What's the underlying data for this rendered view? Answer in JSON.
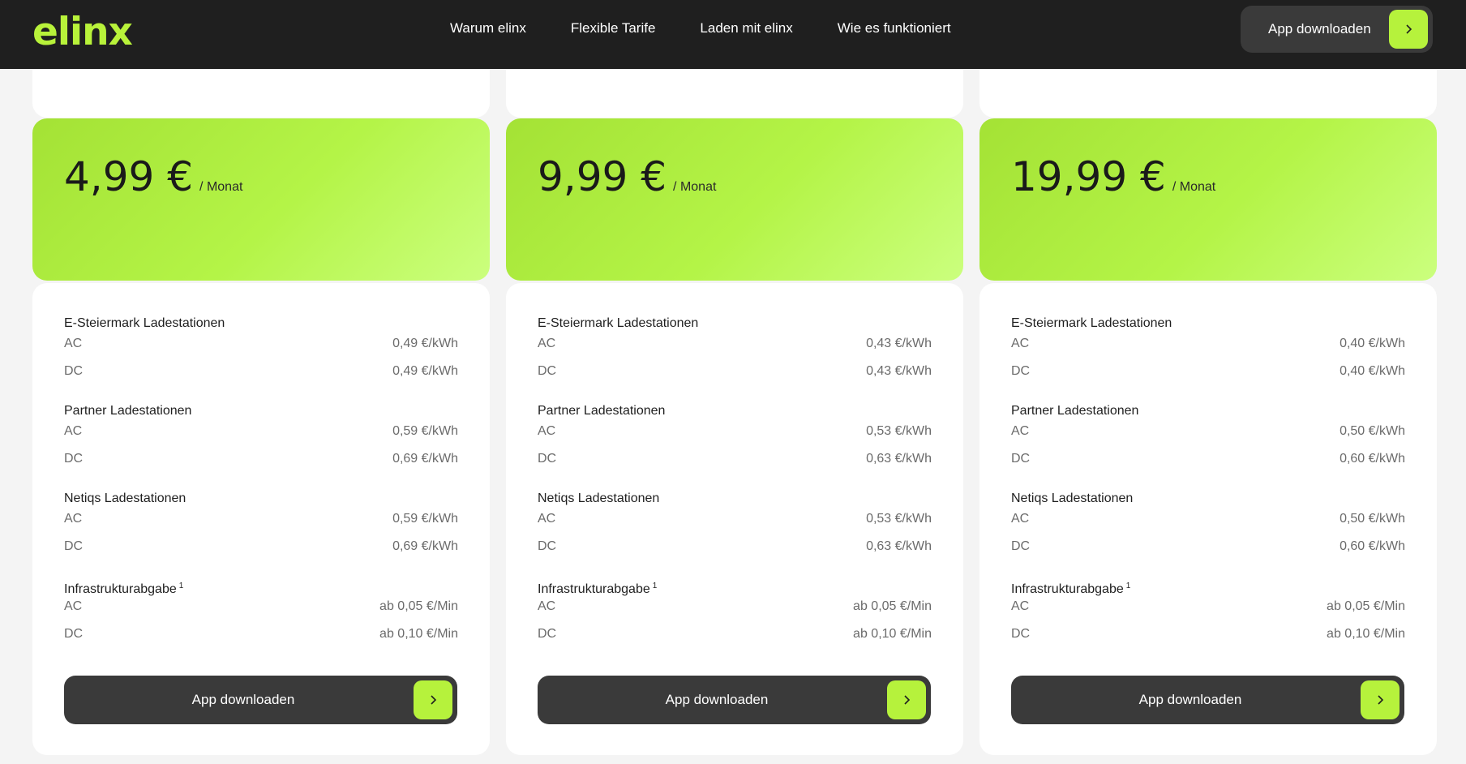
{
  "header": {
    "logo": "elinx",
    "nav": [
      "Warum elinx",
      "Flexible Tarife",
      "Laden mit elinx",
      "Wie es funktioniert"
    ],
    "cta_label": "App downloaden"
  },
  "plans": [
    {
      "price": "4,99 €",
      "period": "/ Monat",
      "groups": [
        {
          "title": "E-Steiermark Ladestationen",
          "rows": [
            {
              "label": "AC",
              "value": "0,49 €/kWh"
            },
            {
              "label": "DC",
              "value": "0,49 €/kWh"
            }
          ]
        },
        {
          "title": "Partner Ladestationen",
          "rows": [
            {
              "label": "AC",
              "value": "0,59 €/kWh"
            },
            {
              "label": "DC",
              "value": "0,69 €/kWh"
            }
          ]
        },
        {
          "title": "Netiqs Ladestationen",
          "rows": [
            {
              "label": "AC",
              "value": "0,59 €/kWh"
            },
            {
              "label": "DC",
              "value": "0,69 €/kWh"
            }
          ]
        },
        {
          "title": "Infrastrukturabgabe",
          "footnote": "1",
          "rows": [
            {
              "label": "AC",
              "value": "ab 0,05 €/Min"
            },
            {
              "label": "DC",
              "value": "ab 0,10 €/Min"
            }
          ]
        }
      ],
      "button": "App downloaden"
    },
    {
      "price": "9,99 €",
      "period": "/ Monat",
      "groups": [
        {
          "title": "E-Steiermark Ladestationen",
          "rows": [
            {
              "label": "AC",
              "value": "0,43 €/kWh"
            },
            {
              "label": "DC",
              "value": "0,43 €/kWh"
            }
          ]
        },
        {
          "title": "Partner Ladestationen",
          "rows": [
            {
              "label": "AC",
              "value": "0,53 €/kWh"
            },
            {
              "label": "DC",
              "value": "0,63 €/kWh"
            }
          ]
        },
        {
          "title": "Netiqs Ladestationen",
          "rows": [
            {
              "label": "AC",
              "value": "0,53 €/kWh"
            },
            {
              "label": "DC",
              "value": "0,63 €/kWh"
            }
          ]
        },
        {
          "title": "Infrastrukturabgabe",
          "footnote": "1",
          "rows": [
            {
              "label": "AC",
              "value": "ab 0,05 €/Min"
            },
            {
              "label": "DC",
              "value": "ab 0,10 €/Min"
            }
          ]
        }
      ],
      "button": "App downloaden"
    },
    {
      "price": "19,99 €",
      "period": "/ Monat",
      "groups": [
        {
          "title": "E-Steiermark Ladestationen",
          "rows": [
            {
              "label": "AC",
              "value": "0,40 €/kWh"
            },
            {
              "label": "DC",
              "value": "0,40 €/kWh"
            }
          ]
        },
        {
          "title": "Partner Ladestationen",
          "rows": [
            {
              "label": "AC",
              "value": "0,50 €/kWh"
            },
            {
              "label": "DC",
              "value": "0,60 €/kWh"
            }
          ]
        },
        {
          "title": "Netiqs Ladestationen",
          "rows": [
            {
              "label": "AC",
              "value": "0,50 €/kWh"
            },
            {
              "label": "DC",
              "value": "0,60 €/kWh"
            }
          ]
        },
        {
          "title": "Infrastrukturabgabe",
          "footnote": "1",
          "rows": [
            {
              "label": "AC",
              "value": "ab 0,05 €/Min"
            },
            {
              "label": "DC",
              "value": "ab 0,10 €/Min"
            }
          ]
        }
      ],
      "button": "App downloaden"
    }
  ],
  "colors": {
    "header_bg": "#1f1f1f",
    "brand_green": "#b6f23c",
    "button_dark": "#3a3a3a",
    "page_bg": "#f4f4f4"
  },
  "icons": {
    "cta_arrow": "chevron-right-icon"
  }
}
